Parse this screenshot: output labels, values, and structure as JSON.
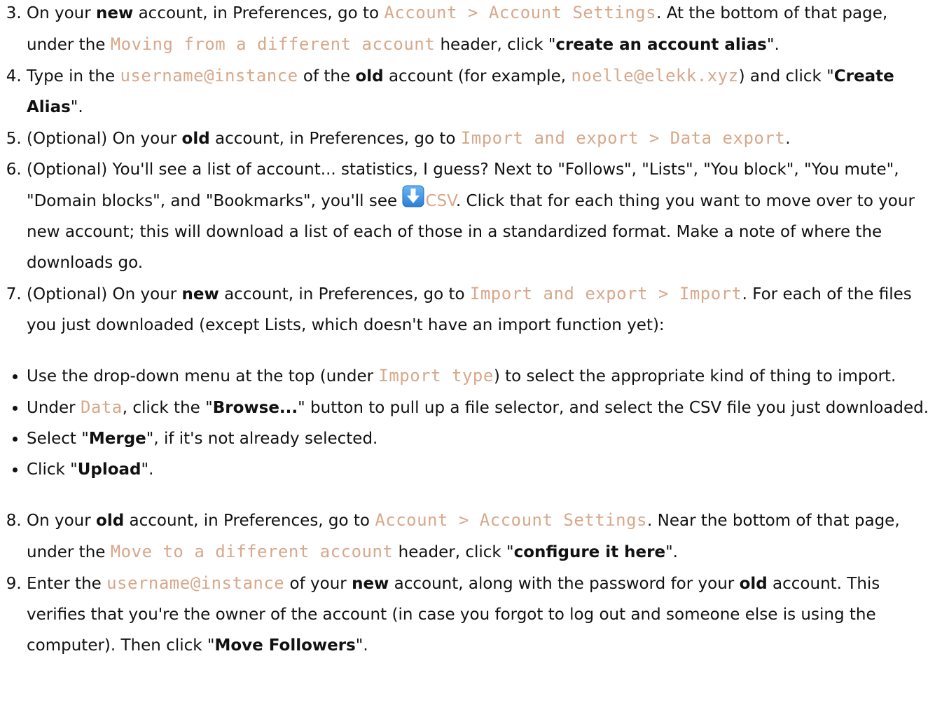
{
  "steps_a": {
    "s3": {
      "t1": "On your ",
      "b1": "new",
      "t2": " account, in Preferences, go to ",
      "c1": "Account > Account Settings",
      "t3": ". At the bottom of that page, under the ",
      "c2": "Moving from a different account",
      "t4": " header, click \"",
      "b2": "create an account alias",
      "t5": "\"."
    },
    "s4": {
      "t1": "Type in the ",
      "c1": "username@instance",
      "t2": " of the ",
      "b1": "old",
      "t3": " account (for example, ",
      "c2": "noelle@elekk.xyz",
      "t4": ") and click \"",
      "b2": "Create Alias",
      "t5": "\"."
    },
    "s5": {
      "t1": "(Optional) On your ",
      "b1": "old",
      "t2": " account, in Preferences, go to ",
      "c1": "Import and export > Data export",
      "t3": "."
    },
    "s6": {
      "t1": "(Optional) You'll see a list of account... statistics, I guess? Next to \"Follows\", \"Lists\", \"You block\", \"You mute\", \"Domain blocks\", and \"Bookmarks\", you'll see ",
      "icon": "download-arrow-icon",
      "link": "CSV",
      "t2": ". Click that for each thing you want to move over to your new account; this will download a list of each of those in a standardized format. Make a note of where the downloads go."
    },
    "s7": {
      "t1": "(Optional) On your ",
      "b1": "new",
      "t2": " account, in Preferences, go to ",
      "c1": "Import and export > Import",
      "t3": ". For each of the files you just downloaded (except Lists, which doesn't have an import function yet):"
    }
  },
  "bullets": {
    "b1": {
      "t1": "Use the drop-down menu at the top (under ",
      "c1": "Import type",
      "t2": ") to select the appropriate kind of thing to import."
    },
    "b2": {
      "t1": "Under ",
      "c1": "Data",
      "t2": ", click the \"",
      "b1": "Browse...",
      "t3": "\" button to pull up a file selector, and select the CSV file you just downloaded."
    },
    "b3": {
      "t1": "Select \"",
      "b1": "Merge",
      "t2": "\", if it's not already selected."
    },
    "b4": {
      "t1": "Click \"",
      "b1": "Upload",
      "t2": "\"."
    }
  },
  "steps_b": {
    "s8": {
      "t1": "On your ",
      "b1": "old",
      "t2": " account, in Preferences, go to ",
      "c1": "Account > Account Settings",
      "t3": ". Near the bottom of that page, under the ",
      "c2": "Move to a different account",
      "t4": " header, click \"",
      "b2": "configure it here",
      "t5": "\"."
    },
    "s9": {
      "t1": "Enter the ",
      "c1": "username@instance",
      "t2": " of your ",
      "b1": "new",
      "t3": " account, along with the password for your ",
      "b2": "old",
      "t4": " account. This verifies that you're the owner of the account (in case you forgot to log out and someone else is using the computer). Then click \"",
      "b3": "Move Followers",
      "t5": "\"."
    }
  },
  "colors": {
    "code": "#d7a88a",
    "text": "#111111",
    "icon": "#3a8fe0"
  }
}
